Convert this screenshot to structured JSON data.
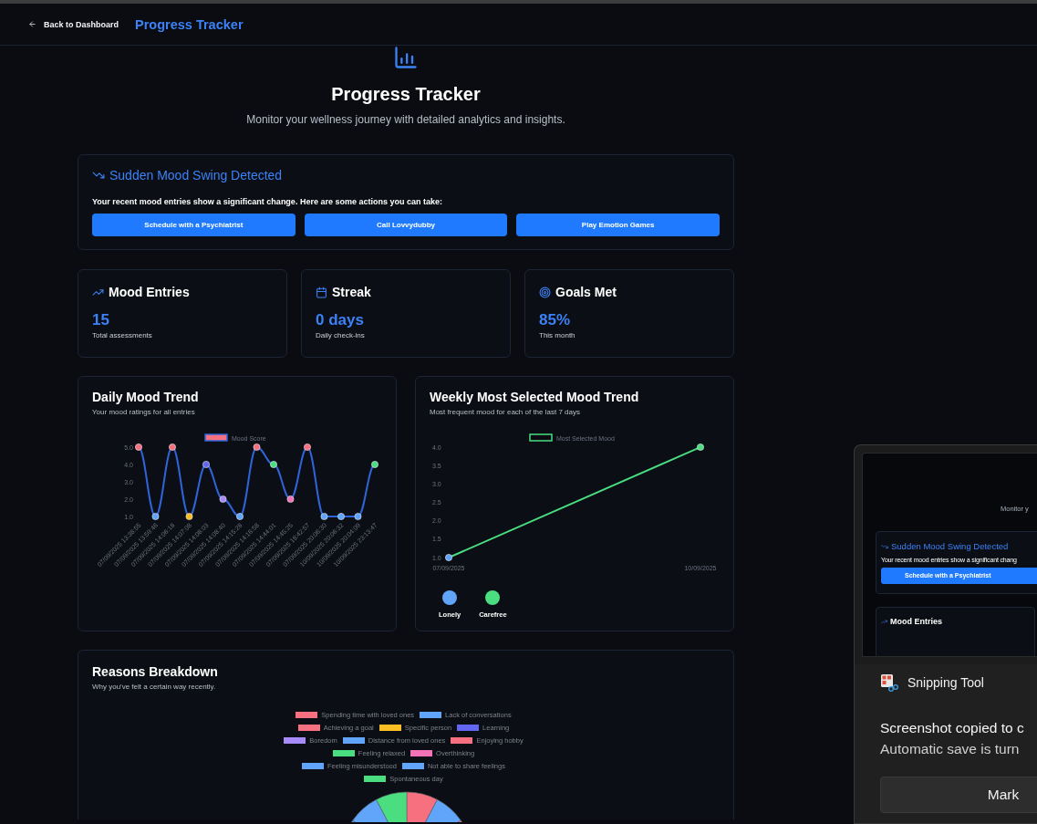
{
  "header": {
    "back_link": "Back to Dashboard",
    "title": "Progress Tracker"
  },
  "hero": {
    "title": "Progress Tracker",
    "subtitle": "Monitor your wellness journey with detailed analytics and insights."
  },
  "alert": {
    "title": "Sudden Mood Swing Detected",
    "message": "Your recent mood entries show a significant change. Here are some actions you can take:",
    "actions": [
      "Schedule with a Psychiatrist",
      "Call Lovvydubby",
      "Play Emotion Games"
    ]
  },
  "stats": [
    {
      "kind": "trend",
      "title": "Mood Entries",
      "value": "15",
      "caption": "Total assessments"
    },
    {
      "kind": "calendar",
      "title": "Streak",
      "value": "0 days",
      "caption": "Daily check-ins"
    },
    {
      "kind": "target",
      "title": "Goals Met",
      "value": "85%",
      "caption": "This month"
    }
  ],
  "daily_trend": {
    "title": "Daily Mood Trend",
    "subtitle": "Your mood ratings for all entries",
    "chart_data": {
      "type": "line",
      "categories": [
        "07/09/2025 13:38:55",
        "07/09/2025 13:59:46",
        "07/09/2025 14:06:18",
        "07/09/2025 14:07:08",
        "07/09/2025 14:08:03",
        "07/09/2025 14:08:40",
        "07/09/2025 14:15:28",
        "07/09/2025 14:16:58",
        "07/09/2025 14:44:01",
        "07/09/2025 14:45:25",
        "07/09/2025 18:42:57",
        "07/09/2025 20:06:30",
        "10/09/2025 20:06:32",
        "10/09/2025 20:04:09",
        "10/09/2025 23:13:47"
      ],
      "series": [
        {
          "name": "Mood Score",
          "color": "#2f64d8",
          "marker": "circle",
          "values": [
            5,
            1,
            5,
            1,
            4,
            2,
            1,
            5,
            4,
            2,
            5,
            1,
            1,
            1,
            4
          ]
        }
      ],
      "ylim": [
        1,
        5
      ],
      "yticks": [
        {
          "value": 1,
          "label": "1.0"
        },
        {
          "value": 2,
          "label": "2.0"
        },
        {
          "value": 3,
          "label": "3.0"
        },
        {
          "value": 4,
          "label": "4.0"
        },
        {
          "value": 5,
          "label": "5.0"
        }
      ]
    },
    "points": [
      {
        "color": "#f6707f"
      },
      {
        "color": "#60a5fa"
      },
      {
        "color": "#f6707f"
      },
      {
        "color": "#fbbf24"
      },
      {
        "color": "#6366f1"
      },
      {
        "color": "#a78bfa"
      },
      {
        "color": "#60a5fa"
      },
      {
        "color": "#f6707f"
      },
      {
        "color": "#4ade80"
      },
      {
        "color": "#f472b6"
      },
      {
        "color": "#f6707f"
      },
      {
        "color": "#60a5fa"
      },
      {
        "color": "#60a5fa"
      },
      {
        "color": "#60a5fa"
      },
      {
        "color": "#4ade80"
      }
    ]
  },
  "weekly_trend": {
    "title": "Weekly Most Selected Mood Trend",
    "subtitle": "Most frequent mood for each of the last 7 days",
    "chart_data": {
      "type": "line",
      "categories": [
        "07/09/2025",
        "10/09/2025"
      ],
      "series": [
        {
          "name": "Most Selected Mood",
          "color": "#4ade80",
          "marker": "circle",
          "values": [
            1,
            4
          ]
        }
      ],
      "ylim": [
        1,
        4
      ],
      "yticks": [
        {
          "value": 1,
          "label": "1.0"
        },
        {
          "value": 1.5,
          "label": "1.5"
        },
        {
          "value": 2,
          "label": "2.0"
        },
        {
          "value": 2.5,
          "label": "2.5"
        },
        {
          "value": 3,
          "label": "3.0"
        },
        {
          "value": 3.5,
          "label": "3.5"
        },
        {
          "value": 4,
          "label": "4.0"
        }
      ]
    },
    "points": [
      {
        "color": "#60a5fa"
      },
      {
        "color": "#4ade80"
      }
    ],
    "moods": [
      {
        "label": "Lonely",
        "color": "#60a5fa"
      },
      {
        "label": "Carefree",
        "color": "#4ade80"
      }
    ]
  },
  "reasons": {
    "title": "Reasons Breakdown",
    "subtitle": "Why you've felt a certain way recently.",
    "legend_rows": [
      [
        {
          "label": "Spending time with loved ones",
          "color": "#f6707f"
        },
        {
          "label": "Lack of conversations",
          "color": "#60a5fa"
        }
      ],
      [
        {
          "label": "Achieving a goal",
          "color": "#f6707f"
        },
        {
          "label": "Specific person",
          "color": "#fbbf24"
        },
        {
          "label": "Learning",
          "color": "#6366f1"
        }
      ],
      [
        {
          "label": "Boredom",
          "color": "#a78bfa"
        },
        {
          "label": "Distance from loved ones",
          "color": "#60a5fa"
        },
        {
          "label": "Enjoying hobby",
          "color": "#f6707f"
        }
      ],
      [
        {
          "label": "Feeling relaxed",
          "color": "#4ade80"
        },
        {
          "label": "Overthinking",
          "color": "#f472b6"
        }
      ],
      [
        {
          "label": "Feeling misunderstood",
          "color": "#60a5fa"
        },
        {
          "label": "Not able to share feelings",
          "color": "#60a5fa"
        }
      ],
      [
        {
          "label": "Spontaneous day",
          "color": "#4ade80"
        }
      ]
    ]
  },
  "snip_toast": {
    "preview": {
      "subtitle": "Monitor y",
      "alert_title": "Sudden Mood Swing Detected",
      "alert_message": "Your recent mood entries show a significant chang",
      "alert_action": "Schedule with a Psychiatrist",
      "stat_title": "Mood Entries"
    },
    "app_name": "Snipping Tool",
    "lines": [
      "Screenshot copied to c",
      "Automatic save is turn"
    ],
    "button": "Mark"
  }
}
